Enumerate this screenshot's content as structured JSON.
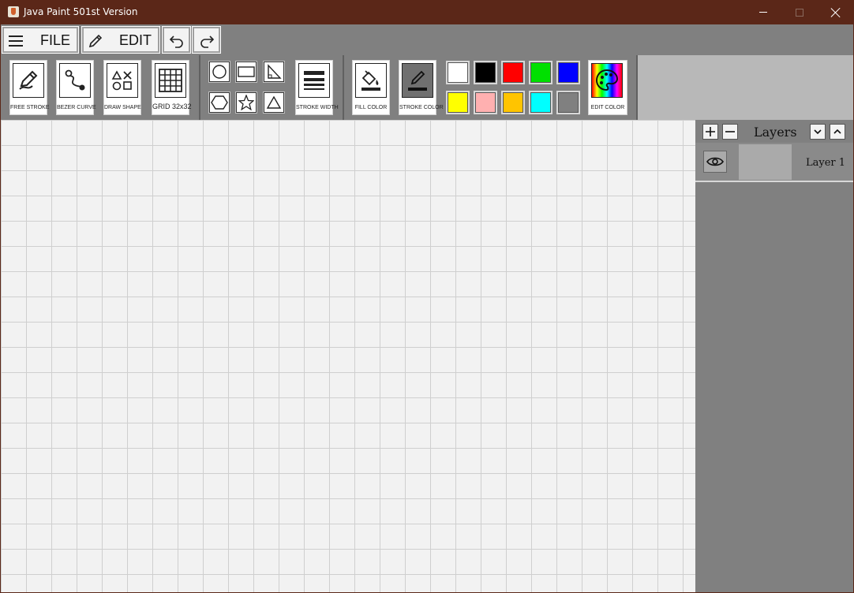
{
  "window": {
    "title": "Java Paint 501st Version",
    "min_icon": "minimize-icon",
    "max_icon": "maximize-icon",
    "close_icon": "close-icon"
  },
  "menu": {
    "file_label": "FILE",
    "edit_label": "EDIT",
    "undo_icon": "undo-icon",
    "redo_icon": "redo-icon"
  },
  "tools": {
    "free_stroke": "FREE STROKE",
    "bezier_curve": "BEZER CURVE",
    "draw_shape": "DRAW SHAPE",
    "grid": "GRID 32x32",
    "stroke_width": "STROKE WIDTH",
    "fill_color": "FILL COLOR",
    "stroke_color": "STROKE COLOR",
    "edit_color": "EDIT COLOR"
  },
  "shapes": [
    "circle",
    "rectangle",
    "right-triangle",
    "hexagon",
    "star",
    "triangle"
  ],
  "palette": [
    "#ffffff",
    "#000000",
    "#ff0000",
    "#00e000",
    "#0000ff",
    "#ffff00",
    "#ffb0b0",
    "#ffc400",
    "#00ffff",
    "#808080"
  ],
  "colors": {
    "titlebar": "#5b2718",
    "toolbar": "#808080",
    "canvas": "#f2f2f2",
    "grid_line": "#cfcfcf"
  },
  "layers": {
    "title": "Layers",
    "items": [
      {
        "name": "Layer 1",
        "visible": true
      }
    ]
  }
}
